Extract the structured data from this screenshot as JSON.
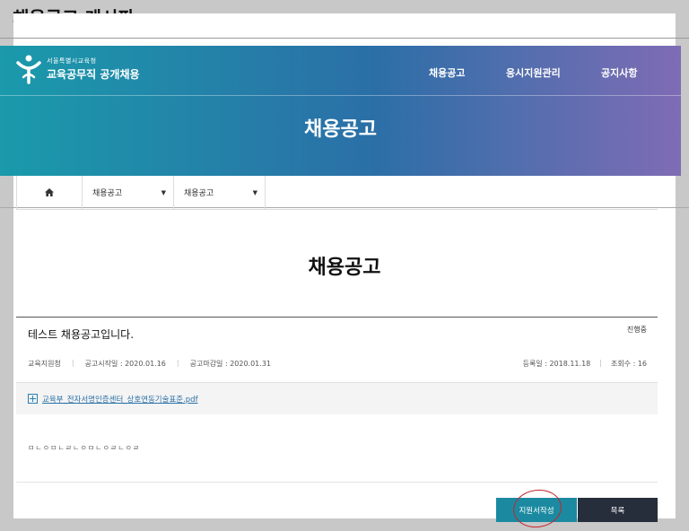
{
  "page_title": "채용공고 게시판",
  "header": {
    "logo_sub": "서울특별시교육청",
    "logo_main": "교육공무직 공개채용",
    "nav": [
      "채용공고",
      "응시지원관리",
      "공지사항"
    ],
    "hero_title": "채용공고"
  },
  "breadcrumb": {
    "home_icon": "home-icon",
    "select1": "채용공고",
    "select2": "채용공고"
  },
  "content_title": "채용공고",
  "post": {
    "title": "테스트 채용공고입니다.",
    "status": "진행중",
    "organization": "교육지원청",
    "start_date": "공고시작일 : 2020.01.16",
    "end_date": "공고마감일 : 2020.01.31",
    "registered": "등록일 : 2018.11.18",
    "views": "조회수 : 16",
    "attachment": "교육부_전자서명인증센터_상호연동기술표준.pdf",
    "body": "ㅁㄴㅇㅁㄴㄹㄴㅇㅁㄴㅇㄹㄴㅇㄹ"
  },
  "buttons": {
    "apply": "지원서작성",
    "list": "목록"
  },
  "colors": {
    "hero_start": "#1a9aab",
    "hero_end": "#7f6cb5",
    "apply_button": "#1b8aa0",
    "list_button": "#262e3b",
    "annotation_circle": "#c0262c"
  }
}
